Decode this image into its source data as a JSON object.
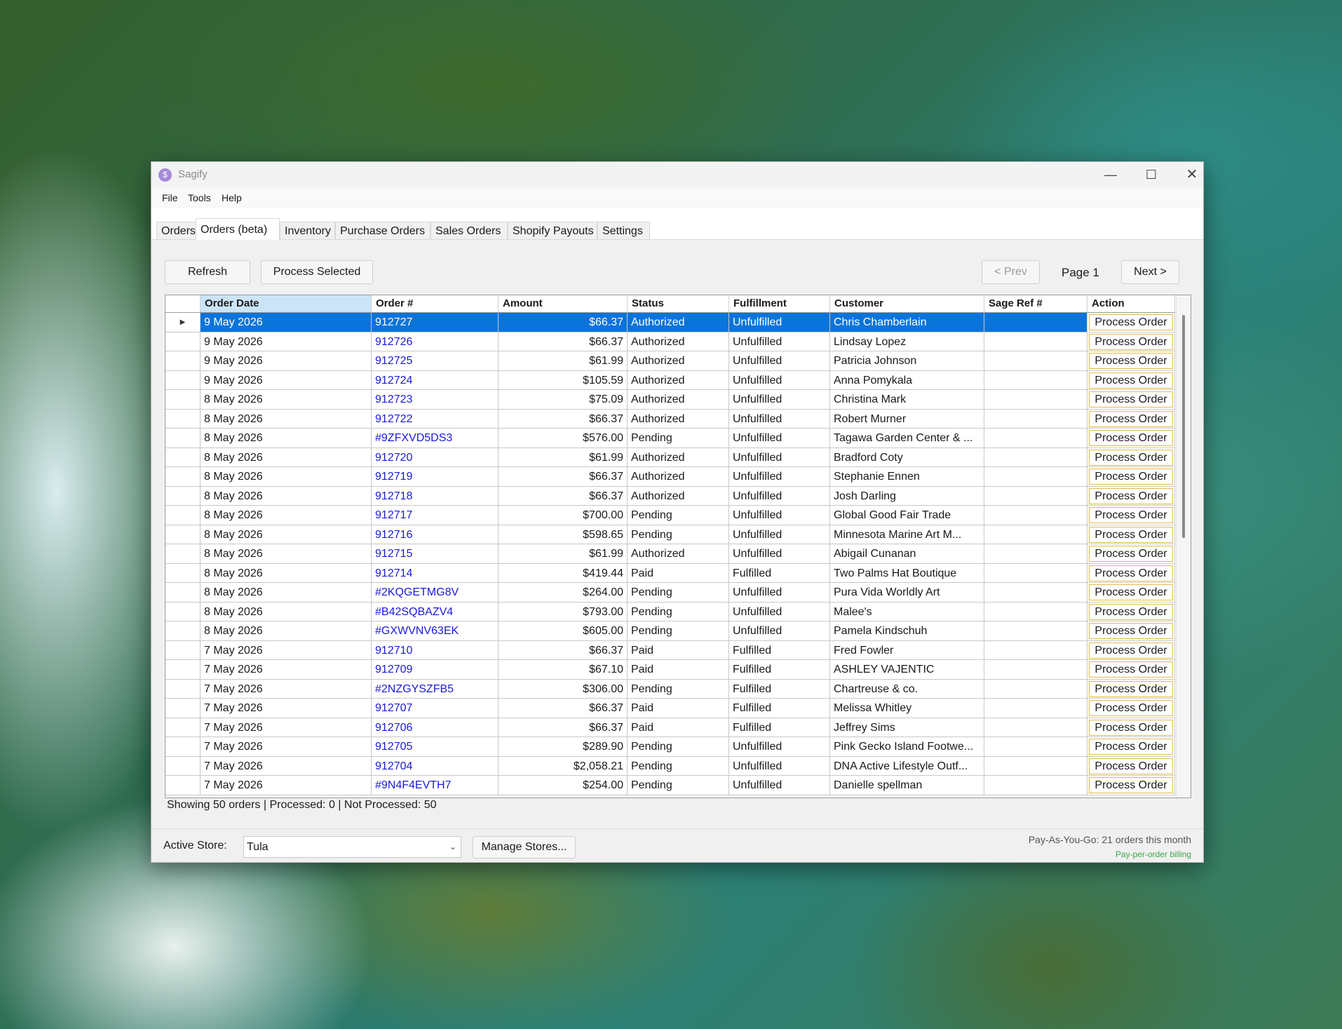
{
  "window": {
    "title": "Sagify",
    "app_icon_glyph": "$",
    "controls": {
      "minimize": "—",
      "maximize": "☐",
      "close": "✕"
    }
  },
  "menu": [
    "File",
    "Tools",
    "Help"
  ],
  "tabs": [
    "Orders",
    "Orders (beta)",
    "Inventory",
    "Purchase Orders",
    "Sales Orders",
    "Shopify Payouts",
    "Settings"
  ],
  "active_tab": "Orders (beta)",
  "toolbar": {
    "refresh_label": "Refresh",
    "process_selected_label": "Process Selected",
    "prev_label": "< Prev",
    "page_label": "Page 1",
    "next_label": "Next >"
  },
  "table": {
    "columns": [
      "Order Date",
      "Order #",
      "Amount",
      "Status",
      "Fulfillment",
      "Customer",
      "Sage Ref #",
      "Action"
    ],
    "sorted_column": "Order Date",
    "action_label": "Process Order",
    "rows": [
      [
        "9 May 2026",
        "912727",
        "$66.37",
        "Authorized",
        "Unfulfilled",
        "Chris Chamberlain",
        ""
      ],
      [
        "9 May 2026",
        "912726",
        "$66.37",
        "Authorized",
        "Unfulfilled",
        "Lindsay Lopez",
        ""
      ],
      [
        "9 May 2026",
        "912725",
        "$61.99",
        "Authorized",
        "Unfulfilled",
        "Patricia Johnson",
        ""
      ],
      [
        "9 May 2026",
        "912724",
        "$105.59",
        "Authorized",
        "Unfulfilled",
        "Anna Pomykala",
        ""
      ],
      [
        "8 May 2026",
        "912723",
        "$75.09",
        "Authorized",
        "Unfulfilled",
        "Christina Mark",
        ""
      ],
      [
        "8 May 2026",
        "912722",
        "$66.37",
        "Authorized",
        "Unfulfilled",
        "Robert Murner",
        ""
      ],
      [
        "8 May 2026",
        "#9ZFXVD5DS3",
        "$576.00",
        "Pending",
        "Unfulfilled",
        "Tagawa Garden Center & ...",
        ""
      ],
      [
        "8 May 2026",
        "912720",
        "$61.99",
        "Authorized",
        "Unfulfilled",
        "Bradford Coty",
        ""
      ],
      [
        "8 May 2026",
        "912719",
        "$66.37",
        "Authorized",
        "Unfulfilled",
        "Stephanie Ennen",
        ""
      ],
      [
        "8 May 2026",
        "912718",
        "$66.37",
        "Authorized",
        "Unfulfilled",
        "Josh Darling",
        ""
      ],
      [
        "8 May 2026",
        "912717",
        "$700.00",
        "Pending",
        "Unfulfilled",
        "Global Good Fair Trade",
        ""
      ],
      [
        "8 May 2026",
        "912716",
        "$598.65",
        "Pending",
        "Unfulfilled",
        "Minnesota Marine Art M...",
        ""
      ],
      [
        "8 May 2026",
        "912715",
        "$61.99",
        "Authorized",
        "Unfulfilled",
        "Abigail Cunanan",
        ""
      ],
      [
        "8 May 2026",
        "912714",
        "$419.44",
        "Paid",
        "Fulfilled",
        "Two Palms Hat Boutique",
        ""
      ],
      [
        "8 May 2026",
        "#2KQGETMG8V",
        "$264.00",
        "Pending",
        "Unfulfilled",
        "Pura Vida Worldly Art",
        ""
      ],
      [
        "8 May 2026",
        "#B42SQBAZV4",
        "$793.00",
        "Pending",
        "Unfulfilled",
        "Malee's",
        ""
      ],
      [
        "8 May 2026",
        "#GXWVNV63EK",
        "$605.00",
        "Pending",
        "Unfulfilled",
        "Pamela Kindschuh",
        ""
      ],
      [
        "7 May 2026",
        "912710",
        "$66.37",
        "Paid",
        "Fulfilled",
        "Fred Fowler",
        ""
      ],
      [
        "7 May 2026",
        "912709",
        "$67.10",
        "Paid",
        "Fulfilled",
        "ASHLEY VAJENTIC",
        ""
      ],
      [
        "7 May 2026",
        "#2NZGYSZFB5",
        "$306.00",
        "Pending",
        "Fulfilled",
        "Chartreuse & co.",
        ""
      ],
      [
        "7 May 2026",
        "912707",
        "$66.37",
        "Paid",
        "Fulfilled",
        "Melissa Whitley",
        ""
      ],
      [
        "7 May 2026",
        "912706",
        "$66.37",
        "Paid",
        "Fulfilled",
        "Jeffrey Sims",
        ""
      ],
      [
        "7 May 2026",
        "912705",
        "$289.90",
        "Pending",
        "Unfulfilled",
        "Pink Gecko Island Footwe...",
        ""
      ],
      [
        "7 May 2026",
        "912704",
        "$2,058.21",
        "Pending",
        "Unfulfilled",
        "DNA Active Lifestyle Outf...",
        ""
      ],
      [
        "7 May 2026",
        "#9N4F4EVTH7",
        "$254.00",
        "Pending",
        "Unfulfilled",
        "Danielle spellman",
        ""
      ]
    ],
    "selected_row": 0,
    "row_indicator_glyph": "▶"
  },
  "status_text": "Showing 50 orders | Processed: 0 | Not Processed: 50",
  "footer": {
    "active_store_label": "Active Store:",
    "active_store_value": "Tula",
    "manage_stores_label": "Manage Stores...",
    "billing_line1": "Pay-As-You-Go: 21 orders this month",
    "billing_line2": "Pay-per-order billing"
  },
  "colors": {
    "selection": "#0a74da",
    "link": "#1a1adc",
    "billing_green": "#3aa84a",
    "action_border": "#e3b94a"
  }
}
